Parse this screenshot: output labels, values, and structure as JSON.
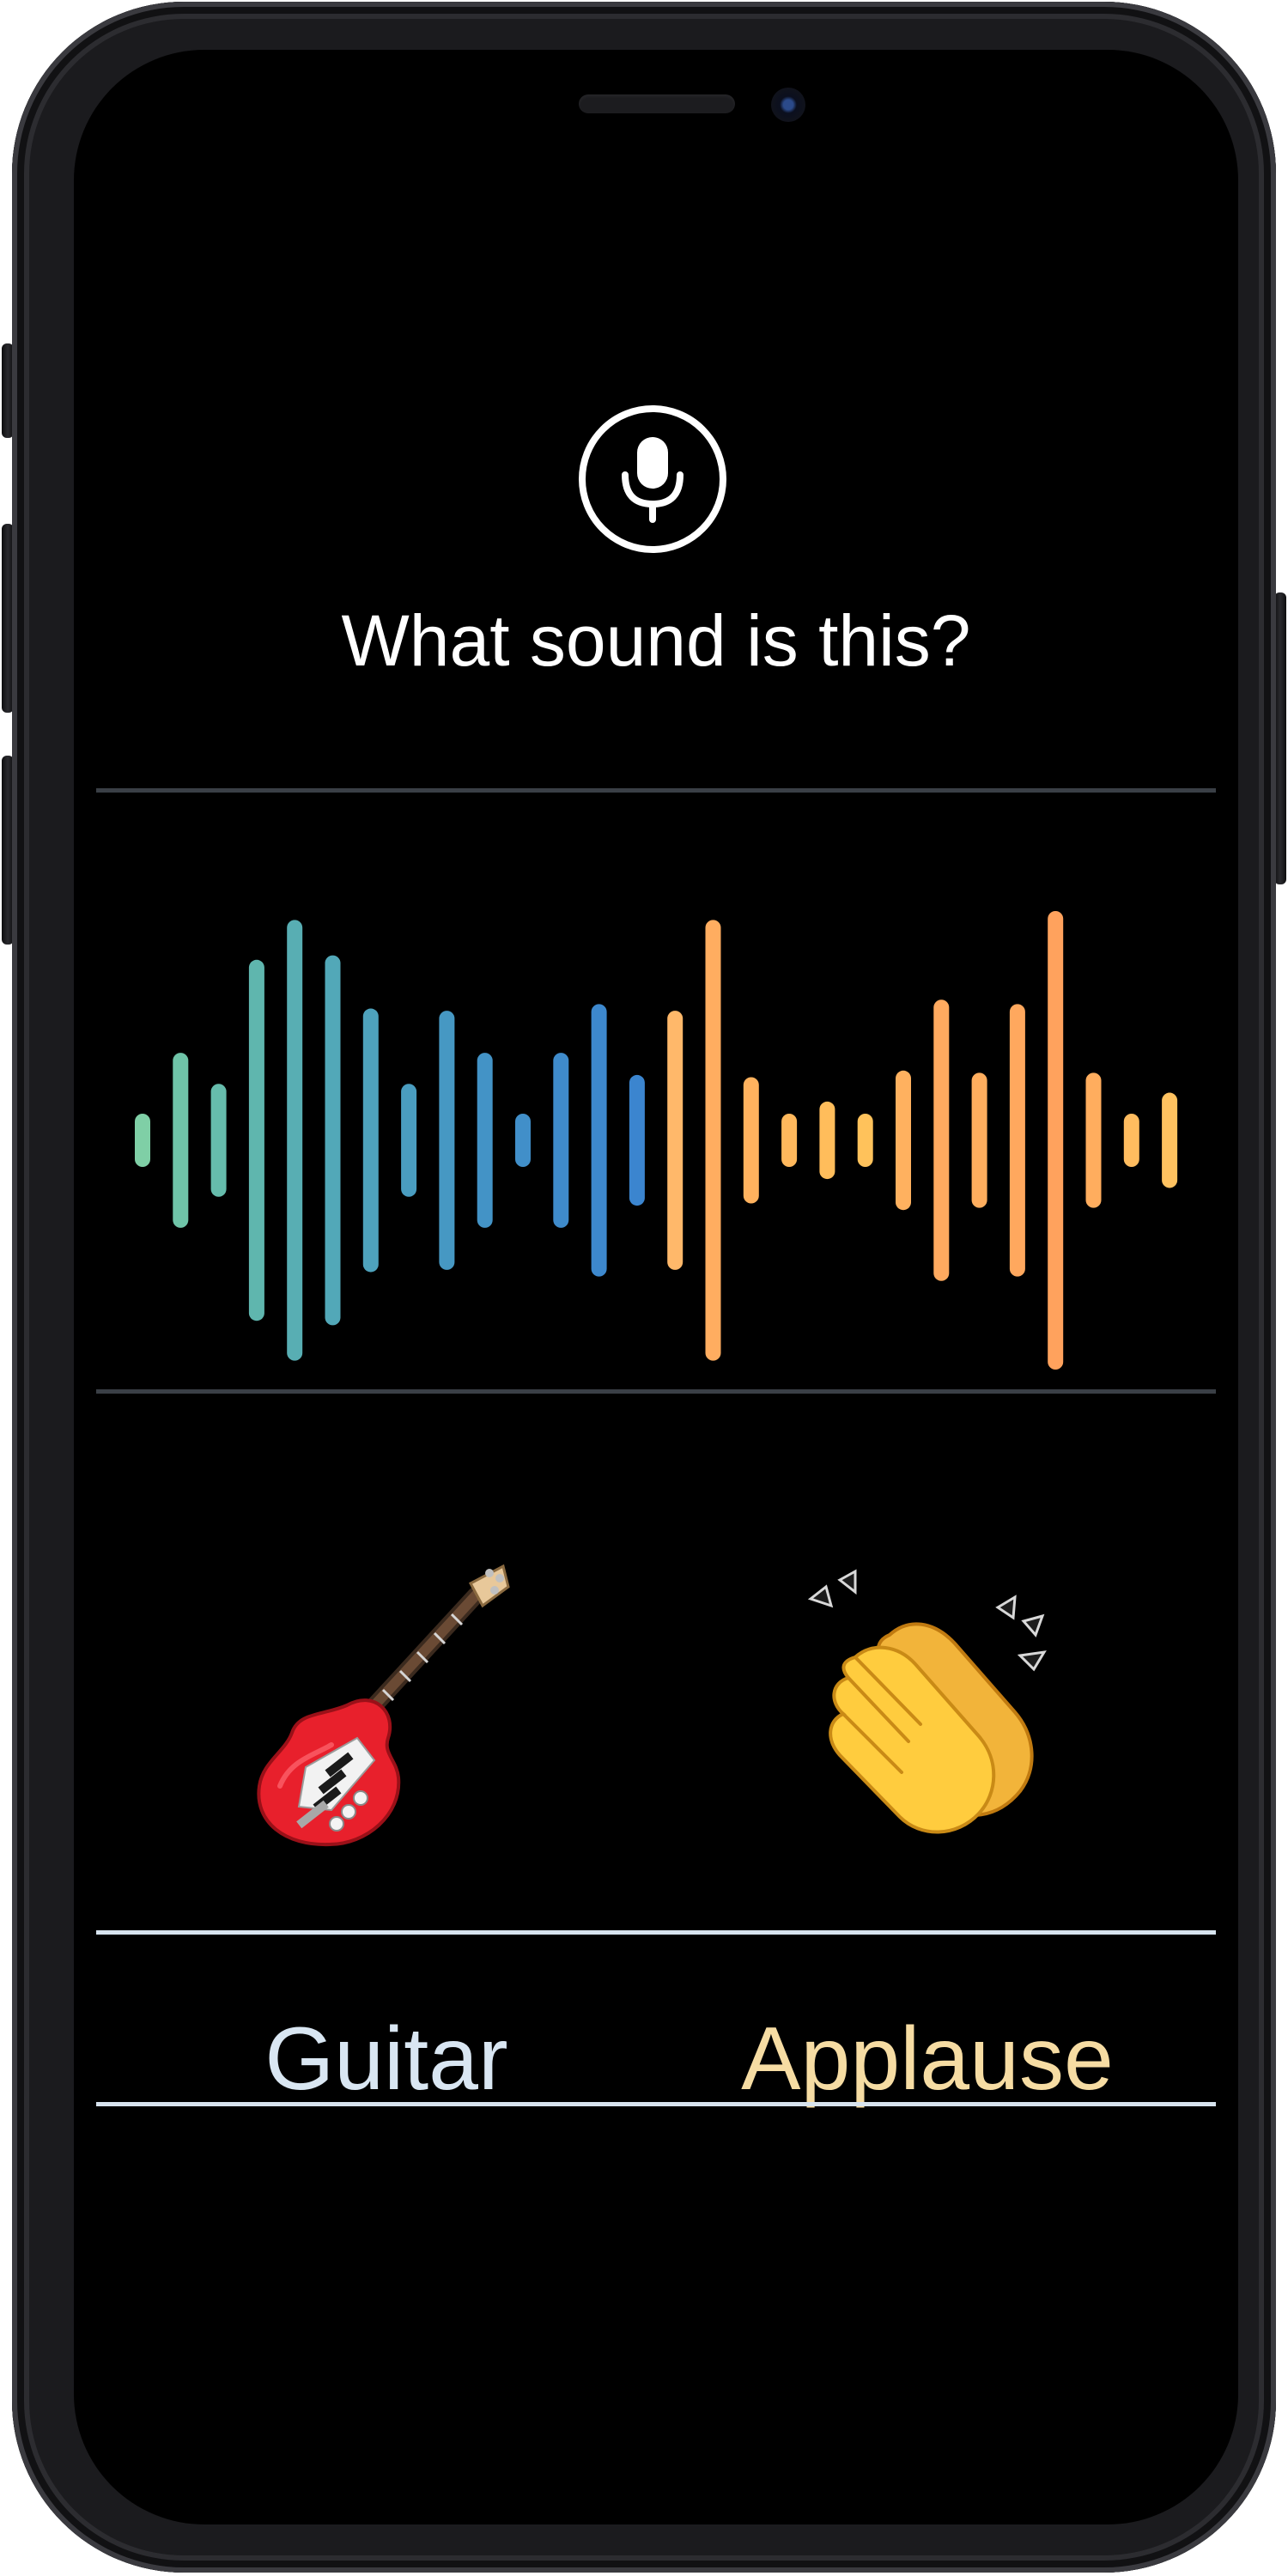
{
  "prompt": {
    "question": "What sound is this?",
    "mic_icon": "microphone-icon"
  },
  "waveform": {
    "bars": [
      {
        "amp": 0.07,
        "color": "#7fcfa6"
      },
      {
        "amp": 0.36,
        "color": "#6fc4a8"
      },
      {
        "amp": 0.22,
        "color": "#66bcac"
      },
      {
        "amp": 0.78,
        "color": "#5fb6ae"
      },
      {
        "amp": 0.96,
        "color": "#58aeb3"
      },
      {
        "amp": 0.8,
        "color": "#52a8b8"
      },
      {
        "amp": 0.56,
        "color": "#4ea2bc"
      },
      {
        "amp": 0.22,
        "color": "#4a9dc0"
      },
      {
        "amp": 0.55,
        "color": "#4698c3"
      },
      {
        "amp": 0.36,
        "color": "#4393c6"
      },
      {
        "amp": 0.07,
        "color": "#418fc9"
      },
      {
        "amp": 0.36,
        "color": "#3f8bcb"
      },
      {
        "amp": 0.58,
        "color": "#3d88cd"
      },
      {
        "amp": 0.26,
        "color": "#3b85cf"
      },
      {
        "amp": 0.55,
        "color": "#ffb86a"
      },
      {
        "amp": 0.96,
        "color": "#ffad60"
      },
      {
        "amp": 0.25,
        "color": "#ffb25e"
      },
      {
        "amp": 0.07,
        "color": "#ffb85c"
      },
      {
        "amp": 0.14,
        "color": "#ffbd5b"
      },
      {
        "amp": 0.07,
        "color": "#ffc25b"
      },
      {
        "amp": 0.28,
        "color": "#ffb15f"
      },
      {
        "amp": 0.6,
        "color": "#ffaa5f"
      },
      {
        "amp": 0.27,
        "color": "#ffae5e"
      },
      {
        "amp": 0.58,
        "color": "#ffa85e"
      },
      {
        "amp": 1.0,
        "color": "#ffa25d"
      },
      {
        "amp": 0.27,
        "color": "#ffad5e"
      },
      {
        "amp": 0.07,
        "color": "#ffbc5f"
      },
      {
        "amp": 0.18,
        "color": "#ffc260"
      }
    ]
  },
  "options": [
    {
      "emoji_icon": "guitar-icon",
      "label": "Guitar",
      "color": "#d9e6f2"
    },
    {
      "emoji_icon": "clapping-hands-icon",
      "label": "Applause",
      "color": "#f6dca3"
    }
  ],
  "colors": {
    "background": "#000000",
    "text": "#ffffff",
    "divider_dark": "#3a3f46",
    "divider_light": "#d7e3ee"
  }
}
